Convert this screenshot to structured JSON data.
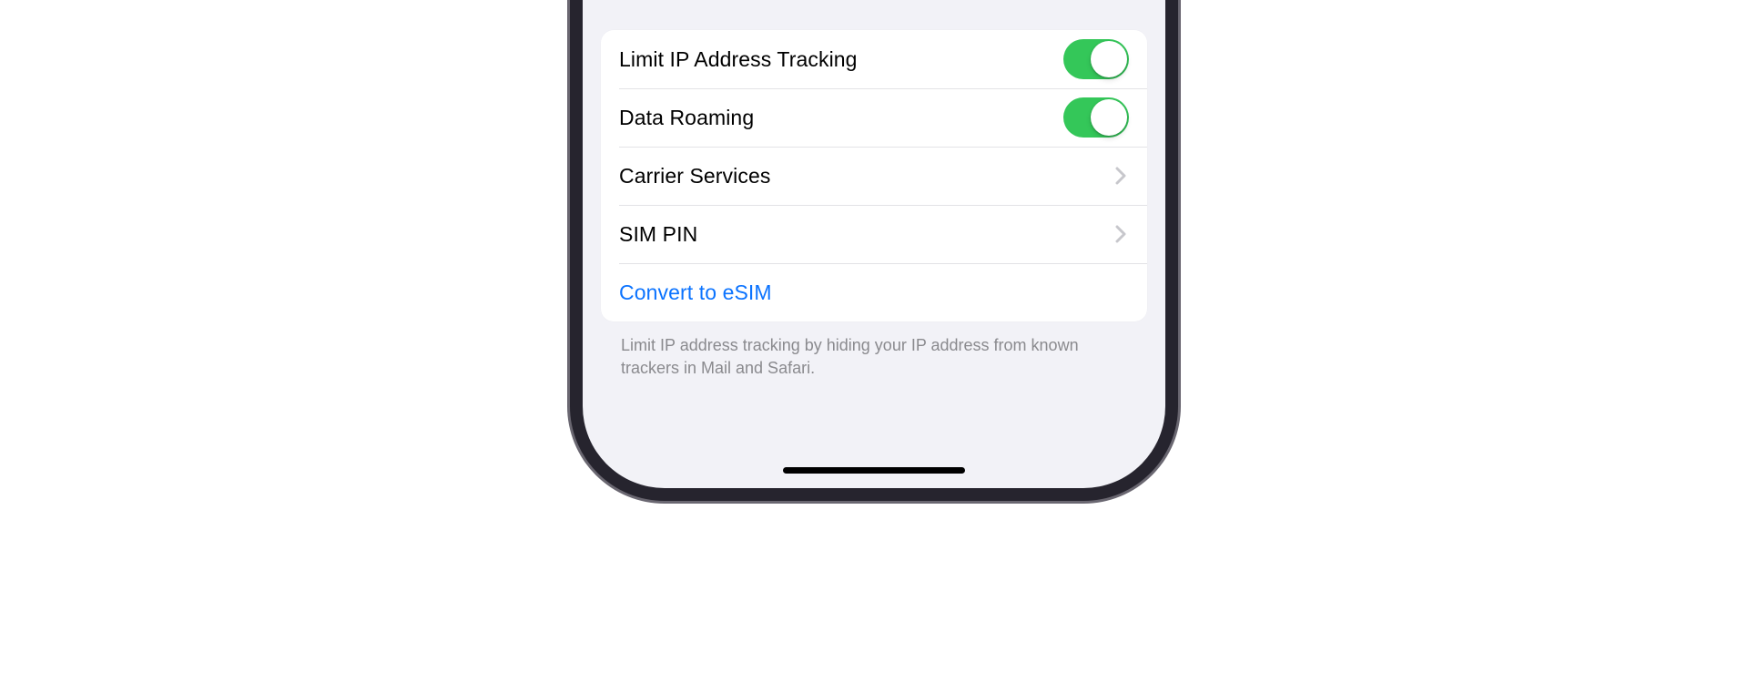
{
  "settings": {
    "rows": [
      {
        "label": "Limit IP Address Tracking",
        "type": "toggle",
        "on": true
      },
      {
        "label": "Data Roaming",
        "type": "toggle",
        "on": true
      },
      {
        "label": "Carrier Services",
        "type": "nav"
      },
      {
        "label": "SIM PIN",
        "type": "nav"
      },
      {
        "label": "Convert to eSIM",
        "type": "link"
      }
    ],
    "footer": "Limit IP address tracking by hiding your IP address from known trackers in Mail and Safari."
  },
  "colors": {
    "accent": "#34c759",
    "link": "#0b73ff"
  }
}
